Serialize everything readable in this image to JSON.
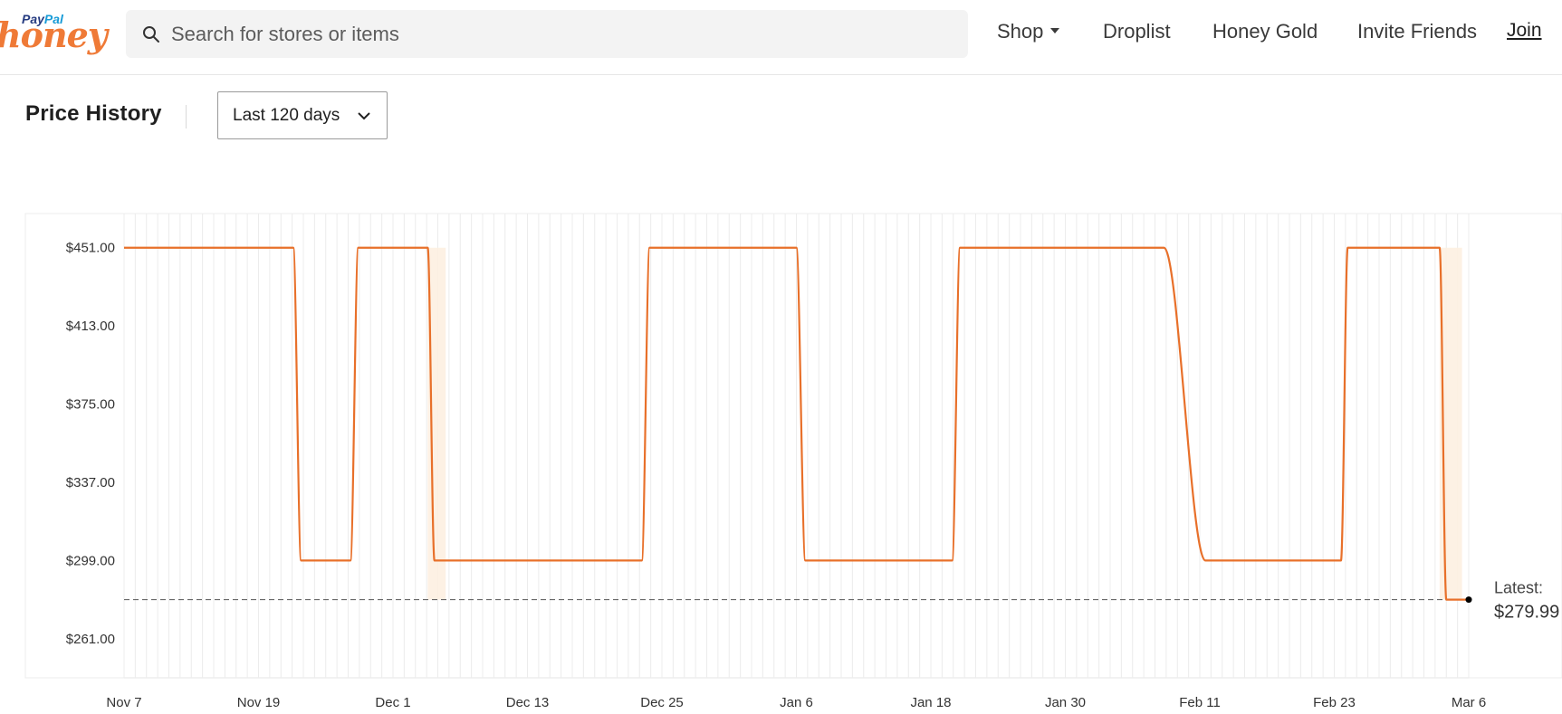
{
  "header": {
    "logo": {
      "paypal_part1": "Pay",
      "paypal_part2": "Pal",
      "honey": "honey"
    },
    "search": {
      "placeholder": "Search for stores or items",
      "value": ""
    },
    "nav": {
      "shop": "Shop",
      "droplist": "Droplist",
      "honey_gold": "Honey Gold",
      "invite_friends": "Invite Friends",
      "join": "Join"
    }
  },
  "price_history": {
    "title": "Price History",
    "range_selected": "Last 120 days"
  },
  "colors": {
    "accent": "#e8702a",
    "band": "#fdf0e1",
    "grid": "#ececec",
    "marker": "#000000"
  },
  "chart_data": {
    "type": "line",
    "title": "",
    "xlabel": "",
    "ylabel": "",
    "y_ticks": [
      "$451.00",
      "$413.00",
      "$375.00",
      "$337.00",
      "$299.00",
      "$261.00"
    ],
    "y_tick_values": [
      451,
      413,
      375,
      337,
      299,
      261
    ],
    "ylim": [
      242,
      467.6
    ],
    "x_ticks": [
      "Nov 7",
      "Nov 19",
      "Dec 1",
      "Dec 13",
      "Dec 25",
      "Jan 6",
      "Jan 18",
      "Jan 30",
      "Feb 11",
      "Feb 23",
      "Mar 6"
    ],
    "x_tick_days": [
      0,
      12,
      24,
      36,
      48,
      60,
      72,
      84,
      96,
      108,
      120
    ],
    "xlim": [
      0,
      120
    ],
    "grid": "vertical daily lines",
    "series": [
      {
        "values_x": [
          0,
          15.1,
          15.8,
          20.2,
          20.9,
          27.1,
          27.7,
          46.2,
          46.9,
          60.0,
          60.8,
          73.9,
          74.6,
          92.8,
          96.5,
          108.6,
          109.2,
          117.4,
          118.0,
          120.0
        ],
        "values_y": [
          451,
          451,
          299,
          299,
          451,
          451,
          299,
          299,
          451,
          451,
          299,
          299,
          451,
          451,
          299,
          299,
          451,
          451,
          279.99,
          279.99
        ]
      }
    ],
    "highlight_bands": [
      {
        "x_start": 27.1,
        "x_end": 28.7
      },
      {
        "x_start": 117.4,
        "x_end": 119.4
      }
    ],
    "reference_line": {
      "y": 279.99
    },
    "latest": {
      "label": "Latest:",
      "value": "$279.99",
      "x": 120,
      "y": 279.99
    }
  }
}
